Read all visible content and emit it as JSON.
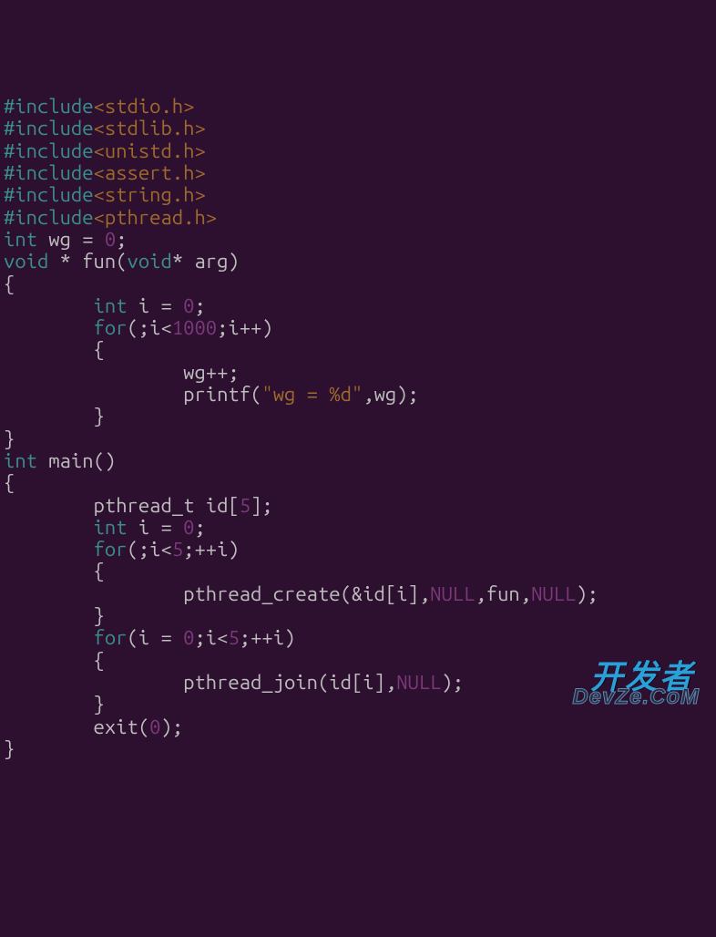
{
  "code": {
    "lines": [
      {
        "segments": [
          {
            "t": "#include",
            "c": "kw"
          },
          {
            "t": "<stdio.h>",
            "c": "hdr"
          }
        ]
      },
      {
        "segments": [
          {
            "t": "#include",
            "c": "kw"
          },
          {
            "t": "<stdlib.h>",
            "c": "hdr"
          }
        ]
      },
      {
        "segments": [
          {
            "t": "#include",
            "c": "kw"
          },
          {
            "t": "<unistd.h>",
            "c": "hdr"
          }
        ]
      },
      {
        "segments": [
          {
            "t": "#include",
            "c": "kw"
          },
          {
            "t": "<assert.h>",
            "c": "hdr"
          }
        ]
      },
      {
        "segments": [
          {
            "t": "#include",
            "c": "kw"
          },
          {
            "t": "<string.h>",
            "c": "hdr"
          }
        ]
      },
      {
        "segments": [
          {
            "t": "#include",
            "c": "kw"
          },
          {
            "t": "<pthread.h>",
            "c": "hdr"
          }
        ]
      },
      {
        "segments": [
          {
            "t": "int",
            "c": "kw"
          },
          {
            "t": " wg = ",
            "c": "ident"
          },
          {
            "t": "0",
            "c": "num"
          },
          {
            "t": ";",
            "c": "ident"
          }
        ]
      },
      {
        "segments": [
          {
            "t": "void",
            "c": "kw"
          },
          {
            "t": " * fun(",
            "c": "ident"
          },
          {
            "t": "void",
            "c": "kw"
          },
          {
            "t": "* arg)",
            "c": "ident"
          }
        ]
      },
      {
        "segments": [
          {
            "t": "{",
            "c": "ident"
          }
        ]
      },
      {
        "segments": [
          {
            "t": "        ",
            "c": "ident"
          },
          {
            "t": "int",
            "c": "kw"
          },
          {
            "t": " i = ",
            "c": "ident"
          },
          {
            "t": "0",
            "c": "num"
          },
          {
            "t": ";",
            "c": "ident"
          }
        ]
      },
      {
        "segments": [
          {
            "t": "        ",
            "c": "ident"
          },
          {
            "t": "for",
            "c": "kw"
          },
          {
            "t": "(;i<",
            "c": "ident"
          },
          {
            "t": "1000",
            "c": "num"
          },
          {
            "t": ";i++)",
            "c": "ident"
          }
        ]
      },
      {
        "segments": [
          {
            "t": "        {",
            "c": "ident"
          }
        ]
      },
      {
        "segments": [
          {
            "t": "                wg++;",
            "c": "ident"
          }
        ]
      },
      {
        "segments": [
          {
            "t": "                printf(",
            "c": "ident"
          },
          {
            "t": "\"wg = %d\"",
            "c": "str"
          },
          {
            "t": ",wg);",
            "c": "ident"
          }
        ]
      },
      {
        "segments": [
          {
            "t": "        }",
            "c": "ident"
          }
        ]
      },
      {
        "segments": [
          {
            "t": "}",
            "c": "ident"
          }
        ]
      },
      {
        "segments": [
          {
            "t": "int",
            "c": "kw"
          },
          {
            "t": " main()",
            "c": "ident"
          }
        ]
      },
      {
        "segments": [
          {
            "t": "{",
            "c": "ident"
          }
        ]
      },
      {
        "segments": [
          {
            "t": "        pthread_t id[",
            "c": "ident"
          },
          {
            "t": "5",
            "c": "num"
          },
          {
            "t": "];",
            "c": "ident"
          }
        ]
      },
      {
        "segments": [
          {
            "t": "        ",
            "c": "ident"
          },
          {
            "t": "int",
            "c": "kw"
          },
          {
            "t": " i = ",
            "c": "ident"
          },
          {
            "t": "0",
            "c": "num"
          },
          {
            "t": ";",
            "c": "ident"
          }
        ]
      },
      {
        "segments": [
          {
            "t": "        ",
            "c": "ident"
          },
          {
            "t": "for",
            "c": "kw"
          },
          {
            "t": "(;i<",
            "c": "ident"
          },
          {
            "t": "5",
            "c": "num"
          },
          {
            "t": ";++i)",
            "c": "ident"
          }
        ]
      },
      {
        "segments": [
          {
            "t": "        {",
            "c": "ident"
          }
        ]
      },
      {
        "segments": [
          {
            "t": "                pthread_create(&id[i],",
            "c": "ident"
          },
          {
            "t": "NULL",
            "c": "const"
          },
          {
            "t": ",fun,",
            "c": "ident"
          },
          {
            "t": "NULL",
            "c": "const"
          },
          {
            "t": ");",
            "c": "ident"
          }
        ]
      },
      {
        "segments": [
          {
            "t": "        }",
            "c": "ident"
          }
        ]
      },
      {
        "segments": [
          {
            "t": "",
            "c": "ident"
          }
        ]
      },
      {
        "segments": [
          {
            "t": "        ",
            "c": "ident"
          },
          {
            "t": "for",
            "c": "kw"
          },
          {
            "t": "(i = ",
            "c": "ident"
          },
          {
            "t": "0",
            "c": "num"
          },
          {
            "t": ";i<",
            "c": "ident"
          },
          {
            "t": "5",
            "c": "num"
          },
          {
            "t": ";++i)",
            "c": "ident"
          }
        ]
      },
      {
        "segments": [
          {
            "t": "        {",
            "c": "ident"
          }
        ]
      },
      {
        "segments": [
          {
            "t": "                pthread_join(id[i],",
            "c": "ident"
          },
          {
            "t": "NULL",
            "c": "const"
          },
          {
            "t": ");",
            "c": "ident"
          }
        ]
      },
      {
        "segments": [
          {
            "t": "        }",
            "c": "ident"
          }
        ]
      },
      {
        "segments": [
          {
            "t": "",
            "c": "ident"
          }
        ]
      },
      {
        "segments": [
          {
            "t": "        exit(",
            "c": "ident"
          },
          {
            "t": "0",
            "c": "num"
          },
          {
            "t": ");",
            "c": "ident"
          }
        ]
      },
      {
        "segments": [
          {
            "t": "}",
            "c": "ident"
          }
        ]
      }
    ]
  },
  "watermark": {
    "line1": "开发者",
    "line2": "DevZe.CoM"
  }
}
